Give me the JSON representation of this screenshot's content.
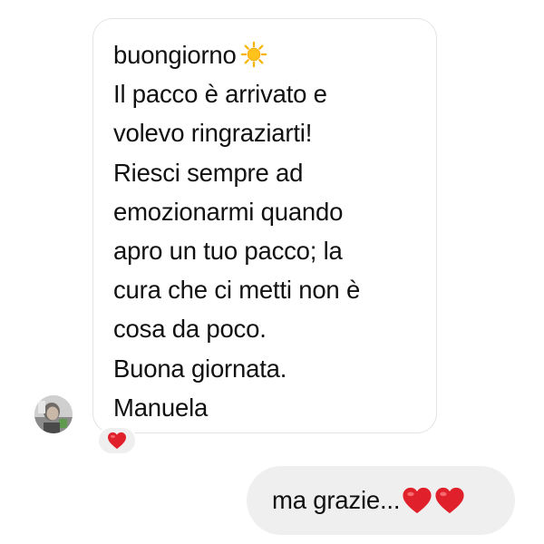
{
  "conversation": {
    "incoming": {
      "lines": [
        "buongiorno",
        "Il pacco è arrivato e",
        "volevo ringraziarti!",
        "Riesci sempre ad",
        "emozionarmi quando",
        "apro un tuo pacco; la",
        "cura che ci metti non è",
        "cosa da poco.",
        "Buona giornata.",
        "Manuela"
      ],
      "emoji": "sun-icon",
      "reaction": "heart-icon"
    },
    "outgoing": {
      "text": "ma grazie...",
      "emojis": [
        "heart-icon",
        "heart-icon"
      ]
    }
  },
  "colors": {
    "background": "#ffffff",
    "incoming_border": "#e3e3e3",
    "outgoing_bubble": "#efefef",
    "text": "#111111",
    "heart": "#e0202a",
    "sun": "#f7b500"
  }
}
